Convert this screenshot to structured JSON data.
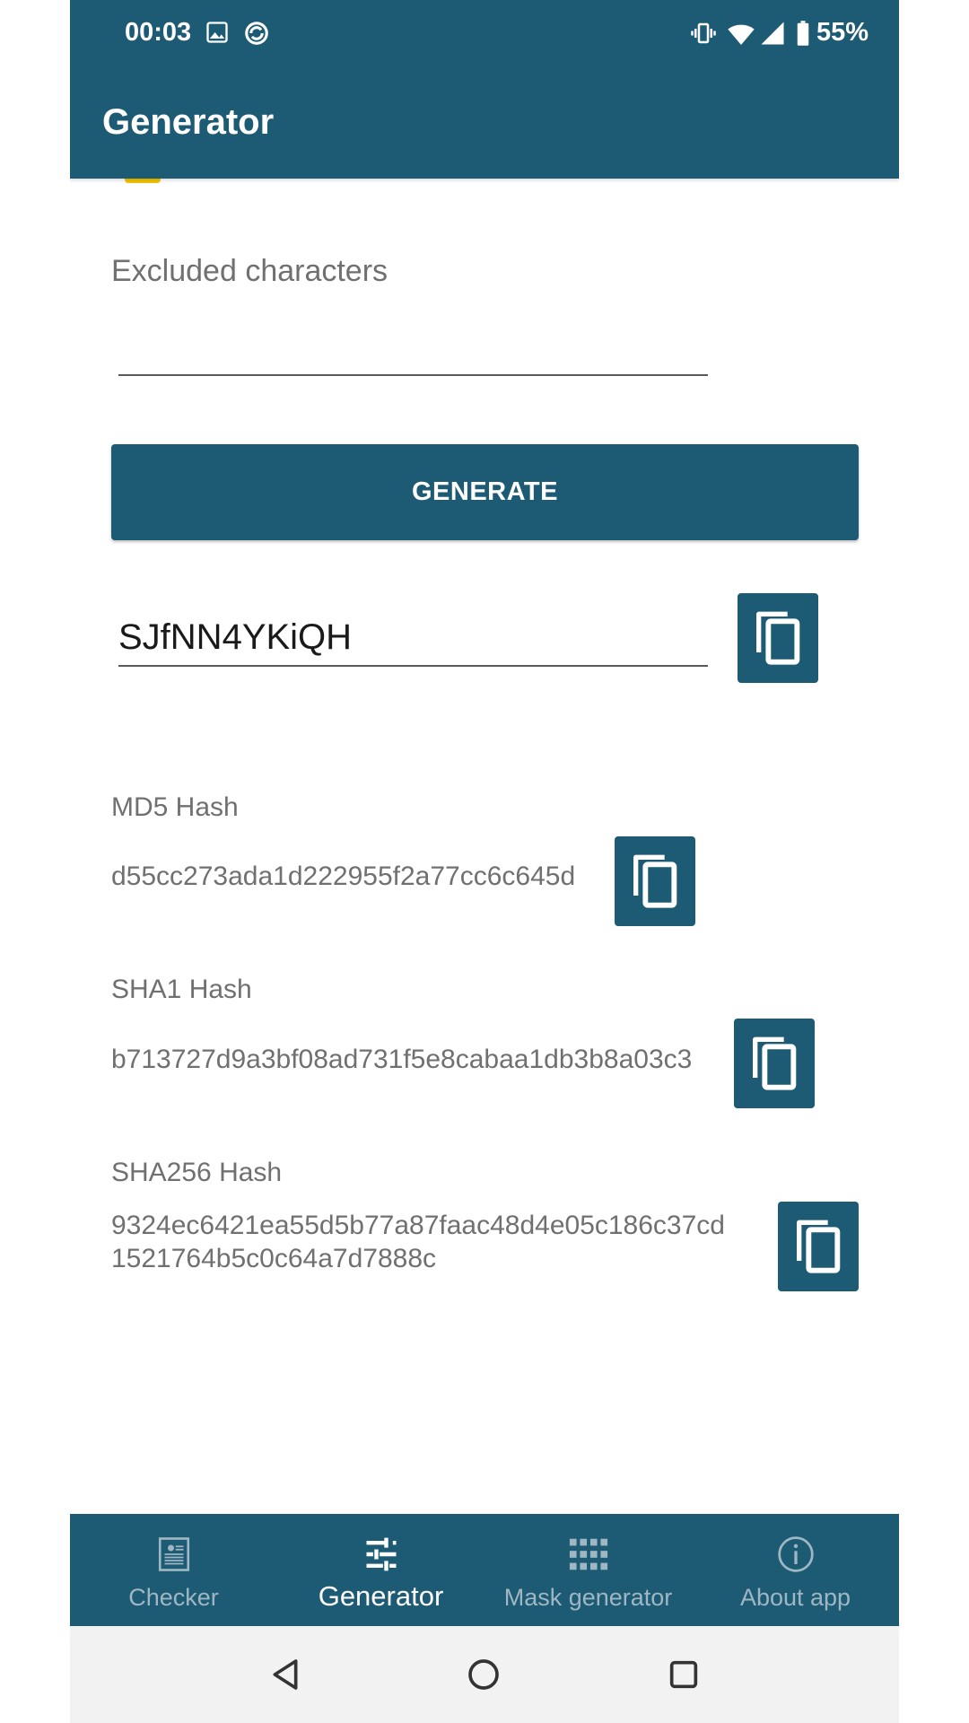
{
  "status_bar": {
    "time": "00:03",
    "battery": "55%",
    "icons": [
      "image-icon",
      "sync-icon",
      "vibrate-icon",
      "wifi-icon",
      "signal-icon",
      "battery-icon"
    ]
  },
  "app_bar": {
    "title": "Generator"
  },
  "form": {
    "excluded_label": "Excluded characters",
    "excluded_value": "",
    "generate_label": "GENERATE",
    "password_value": "SJfNN4YKiQH"
  },
  "hashes": {
    "md5": {
      "label": "MD5 Hash",
      "value": "d55cc273ada1d222955f2a77cc6c645d"
    },
    "sha1": {
      "label": "SHA1 Hash",
      "value": "b713727d9a3bf08ad731f5e8cabaa1db3b8a03c3"
    },
    "sha256": {
      "label": "SHA256 Hash",
      "value_line1": "9324ec6421ea55d5b77a87faac48d4e05c186c37cd",
      "value_line2": "1521764b5c0c64a7d7888c"
    }
  },
  "bottom_nav": {
    "items": [
      {
        "label": "Checker",
        "icon": "checker-icon"
      },
      {
        "label": "Generator",
        "icon": "sliders-icon",
        "active": true
      },
      {
        "label": "Mask generator",
        "icon": "grid-icon"
      },
      {
        "label": "About app",
        "icon": "info-icon"
      }
    ]
  },
  "colors": {
    "primary": "#1d5a74",
    "accent": "#f3c200"
  }
}
